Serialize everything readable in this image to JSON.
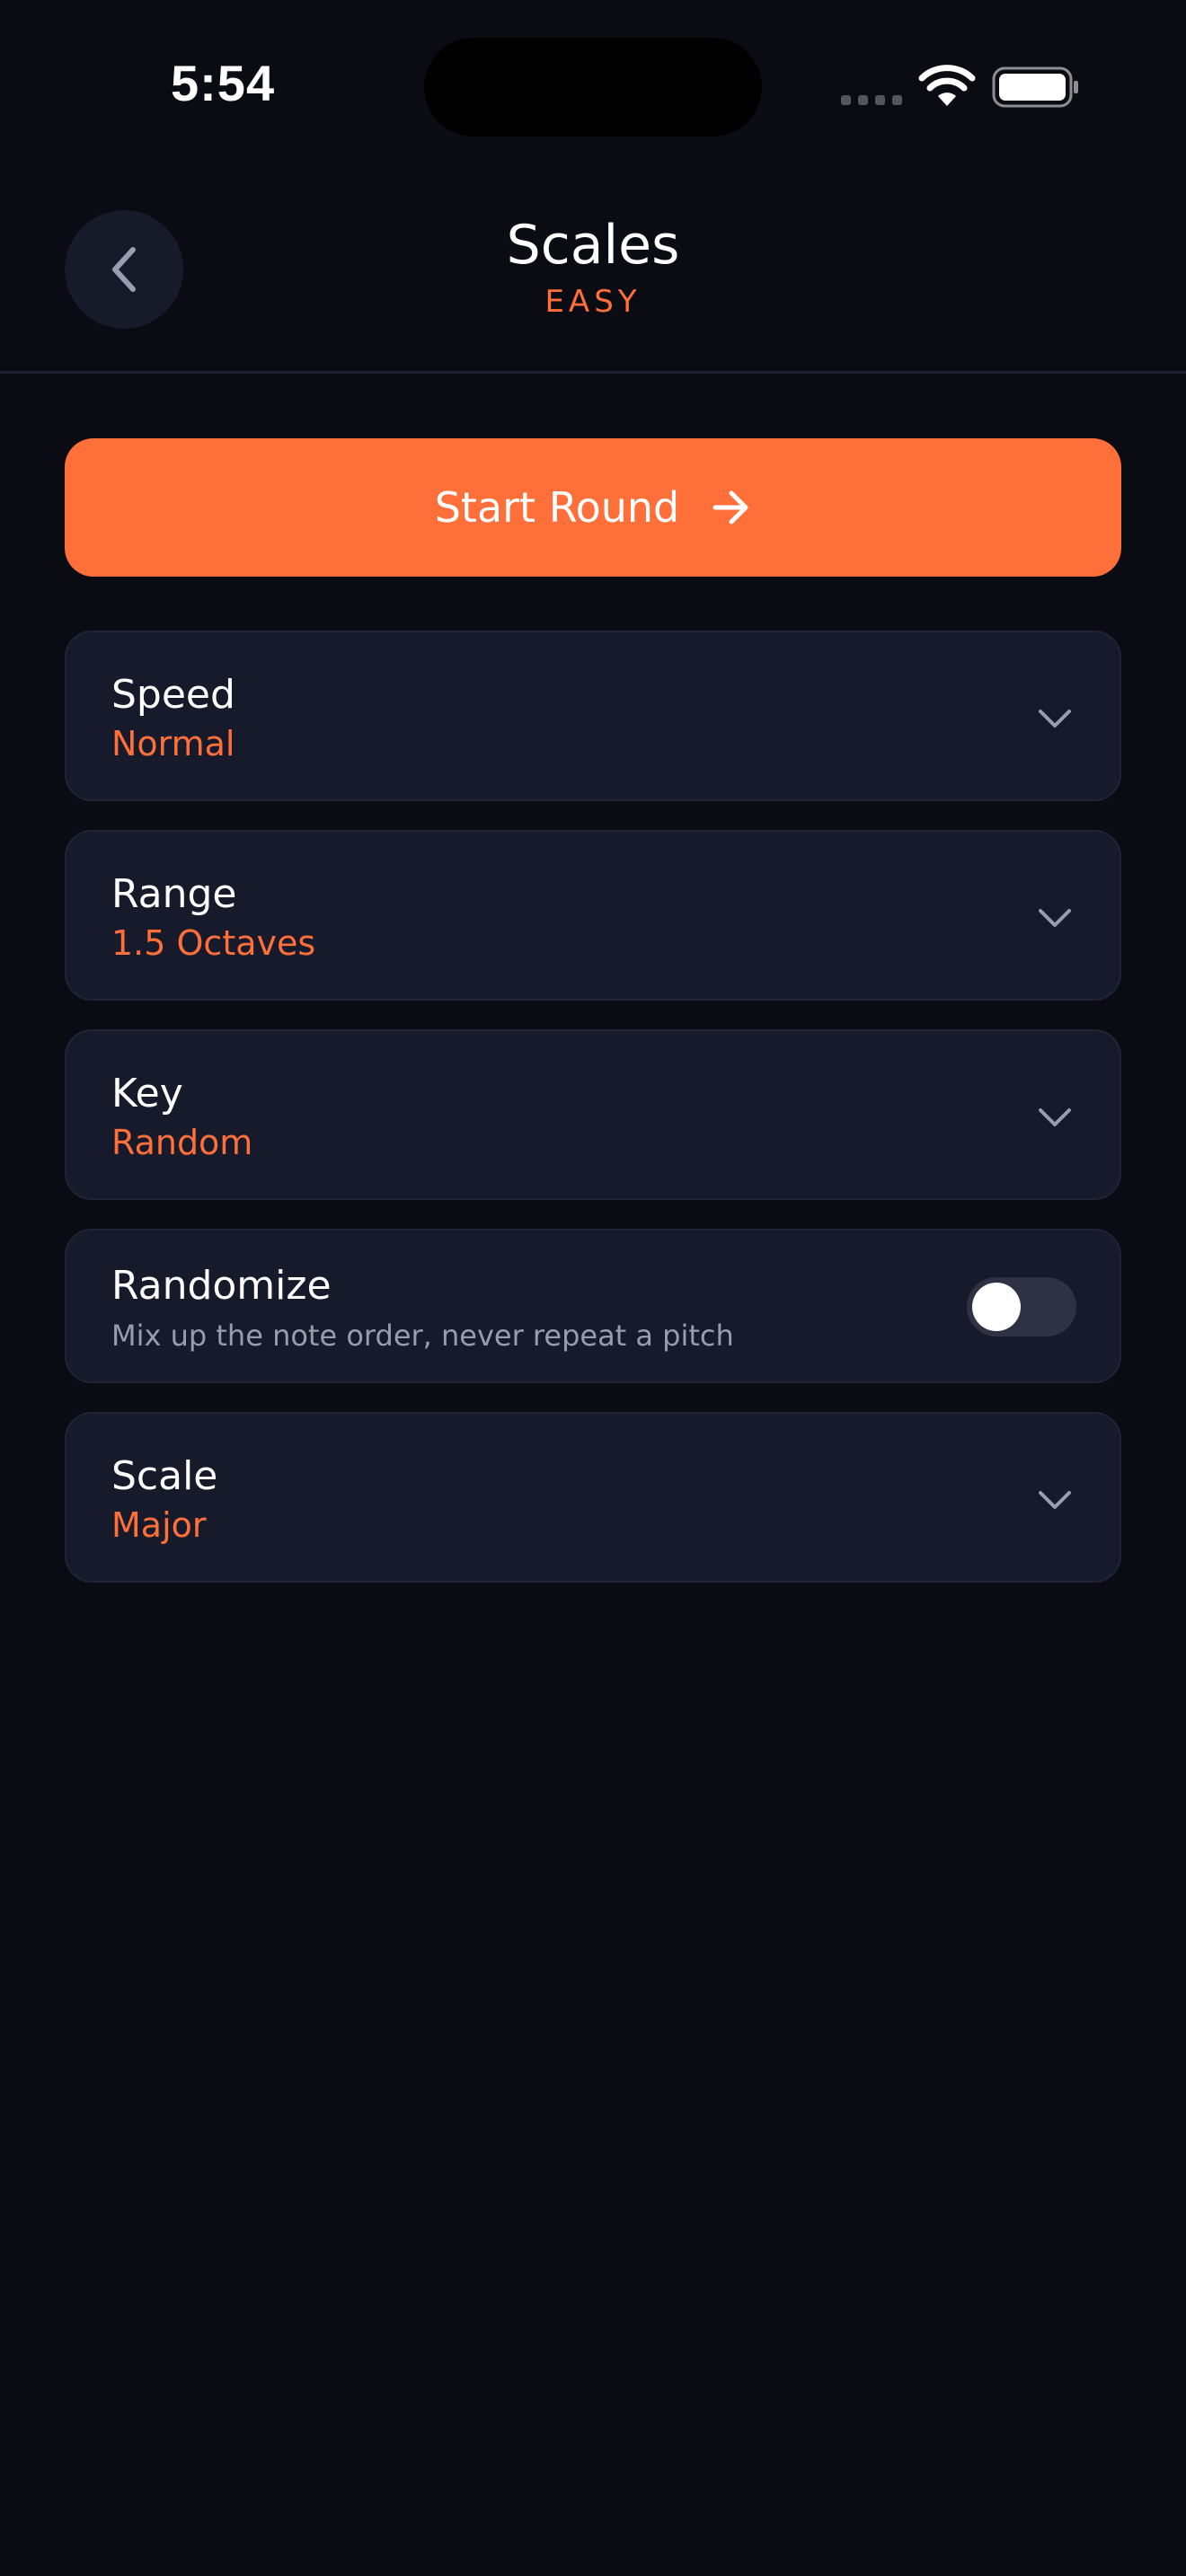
{
  "status_bar": {
    "time": "5:54"
  },
  "header": {
    "title": "Scales",
    "subtitle": "EASY"
  },
  "start_button": {
    "label": "Start Round"
  },
  "settings": [
    {
      "label": "Speed",
      "value": "Normal"
    },
    {
      "label": "Range",
      "value": "1.5 Octaves"
    },
    {
      "label": "Key",
      "value": "Random"
    },
    {
      "label": "Randomize",
      "description": "Mix up the note order, never repeat a pitch",
      "enabled": false
    },
    {
      "label": "Scale",
      "value": "Major"
    }
  ],
  "colors": {
    "accent": "#ff6f3a",
    "background": "#0b0b14",
    "card": "#161a2b"
  },
  "icons": {
    "back": "chevron-left-icon",
    "start": "arrow-right-icon",
    "dropdown": "chevron-down-icon",
    "wifi": "wifi-icon",
    "battery": "battery-icon"
  }
}
